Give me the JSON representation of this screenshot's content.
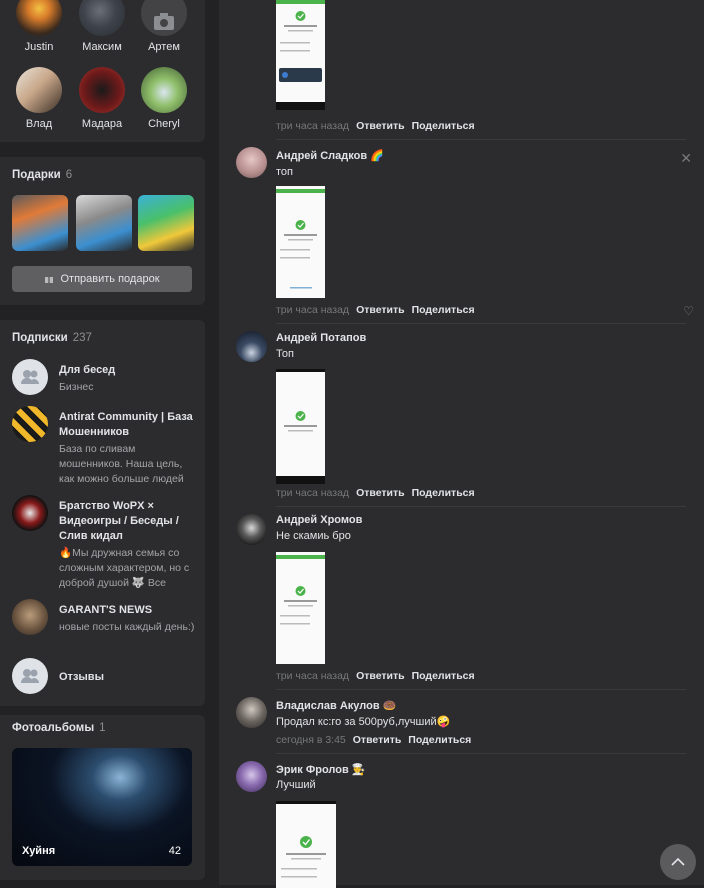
{
  "friends": [
    {
      "name": "Justin"
    },
    {
      "name": "Максим"
    },
    {
      "name": "Артем"
    },
    {
      "name": "Влад"
    },
    {
      "name": "Мадара"
    },
    {
      "name": "Cheryl"
    }
  ],
  "gifts": {
    "title": "Подарки",
    "count": "6",
    "send_label": "Отправить подарок",
    "icon": "gift-icon"
  },
  "subscriptions": {
    "title": "Подписки",
    "count": "237",
    "items": [
      {
        "name": "Для бесед",
        "desc": "Бизнес"
      },
      {
        "name": "Antirat Community | База Мошенников",
        "desc": "База по сливам мошенников. Наша цель, как можно больше людей"
      },
      {
        "name": "Братство WoPX × Видеоигры / Беседы / Слив кидал",
        "desc": "🔥Мы дружная семья со сложным характером, но с доброй душой 🐺 Все"
      },
      {
        "name": "GARANT'S NEWS",
        "desc": "новые посты каждый день:)"
      },
      {
        "name": "Отзывы",
        "desc": ""
      }
    ]
  },
  "albums": {
    "title": "Фотоальбомы",
    "count": "1",
    "album_name": "Хуйня",
    "album_count": "42"
  },
  "comments": [
    {
      "time": "три часа назад",
      "reply": "Ответить",
      "share": "Поделиться"
    },
    {
      "author": "Андрей Сладков 🌈",
      "text": "топ",
      "time": "три часа назад",
      "reply": "Ответить",
      "share": "Поделиться"
    },
    {
      "author": "Андрей Потапов",
      "text": "Топ",
      "time": "три часа назад",
      "reply": "Ответить",
      "share": "Поделиться"
    },
    {
      "author": "Андрей Хромов",
      "text": "Не скамиь бро",
      "time": "три часа назад",
      "reply": "Ответить",
      "share": "Поделиться"
    },
    {
      "author": "Владислав Акулов 🍩",
      "text": "Продал кс:го за 500руб,лучший🤪",
      "time": "сегодня в 3:45",
      "reply": "Ответить",
      "share": "Поделиться"
    },
    {
      "author": "Эрик Фролов 👨‍🍳",
      "text": "Лучший"
    }
  ],
  "colors": {
    "bg": "#222224",
    "card": "#2c2c2e",
    "accent": "#4bb34b"
  }
}
